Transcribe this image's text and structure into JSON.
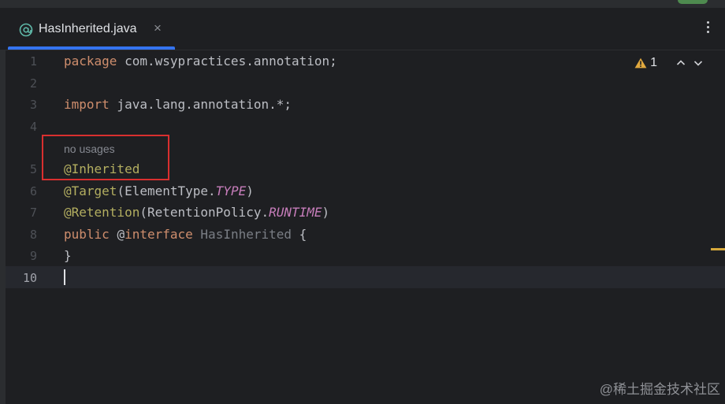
{
  "tab": {
    "file_name": "HasInherited.java",
    "close_glyph": "×",
    "icon": "annotation-at-icon"
  },
  "menu_glyph": "more-vertical-icon",
  "inspection": {
    "warning_count": "1",
    "warning_color": "#e0a83e"
  },
  "lines": [
    {
      "number": "1"
    },
    {
      "number": "2"
    },
    {
      "number": "3"
    },
    {
      "number": "4"
    },
    {
      "number": "5"
    },
    {
      "number": "6"
    },
    {
      "number": "7"
    },
    {
      "number": "8"
    },
    {
      "number": "9"
    },
    {
      "number": "10"
    }
  ],
  "code": {
    "l1_kw": "package",
    "l1_rest": " com.wsypractices.annotation;",
    "l3_kw": "import",
    "l3_rest": " java.lang.annotation.*;",
    "hint": "no usages",
    "l5_ann": "@Inherited",
    "l6_ann": "@Target",
    "l6_open": "(ElementType.",
    "l6_const": "TYPE",
    "l6_close": ")",
    "l7_ann": "@Retention",
    "l7_open": "(RetentionPolicy.",
    "l7_const": "RUNTIME",
    "l7_close": ")",
    "l8_kw": "public",
    "l8_sp": " ",
    "l8_at": "@",
    "l8_kw2": "interface",
    "l8_sp2": " ",
    "l8_name": "HasInherited",
    "l8_brace": " {",
    "l9": "}"
  },
  "colors": {
    "keyword": "#cf8e6d",
    "annotation": "#b3ae60",
    "constant": "#c77dbb",
    "accent": "#3574f0",
    "highlight_box": "#d92f2f"
  },
  "watermark": "@稀土掘金技术社区"
}
